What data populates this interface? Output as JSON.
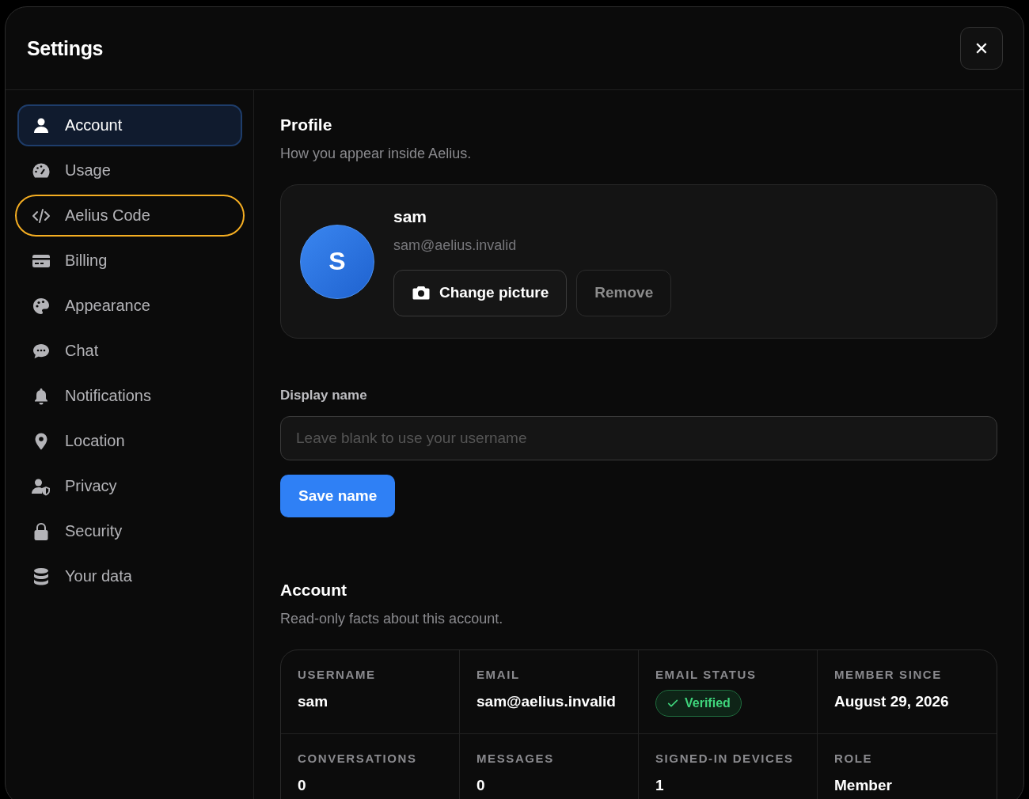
{
  "window": {
    "title": "Settings",
    "close": "✕"
  },
  "sidebar": {
    "items": [
      {
        "label": "Account",
        "selected": true,
        "highlighted": false
      },
      {
        "label": "Usage",
        "selected": false,
        "highlighted": false
      },
      {
        "label": "Aelius Code",
        "selected": false,
        "highlighted": true
      },
      {
        "label": "Billing",
        "selected": false,
        "highlighted": false
      },
      {
        "label": "Appearance",
        "selected": false,
        "highlighted": false
      },
      {
        "label": "Chat",
        "selected": false,
        "highlighted": false
      },
      {
        "label": "Notifications",
        "selected": false,
        "highlighted": false
      },
      {
        "label": "Location",
        "selected": false,
        "highlighted": false
      },
      {
        "label": "Privacy",
        "selected": false,
        "highlighted": false
      },
      {
        "label": "Security",
        "selected": false,
        "highlighted": false
      },
      {
        "label": "Your data",
        "selected": false,
        "highlighted": false
      }
    ]
  },
  "profile": {
    "title": "Profile",
    "subtitle": "How you appear inside Aelius.",
    "avatar_initial": "S",
    "name": "sam",
    "email": "sam@aelius.invalid",
    "buttons": [
      "Change picture",
      "Remove"
    ]
  },
  "display_name": {
    "label": "Display name",
    "placeholder": "Leave blank to use your username",
    "button": "Save name"
  },
  "account": {
    "title": "Account",
    "subtitle": "Read-only facts about this account.",
    "facts": [
      {
        "label": "USERNAME",
        "value": "sam",
        "kind": "text"
      },
      {
        "label": "EMAIL",
        "value": "sam@aelius.invalid",
        "kind": "text"
      },
      {
        "label": "EMAIL STATUS",
        "value": "Verified",
        "kind": "badge"
      },
      {
        "label": "MEMBER SINCE",
        "value": "August 29, 2026",
        "kind": "text"
      },
      {
        "label": "CONVERSATIONS",
        "value": "0",
        "kind": "text"
      },
      {
        "label": "MESSAGES",
        "value": "0",
        "kind": "text"
      },
      {
        "label": "SIGNED-IN DEVICES",
        "value": "1",
        "kind": "text"
      },
      {
        "label": "ROLE",
        "value": "Member",
        "kind": "text"
      }
    ]
  }
}
